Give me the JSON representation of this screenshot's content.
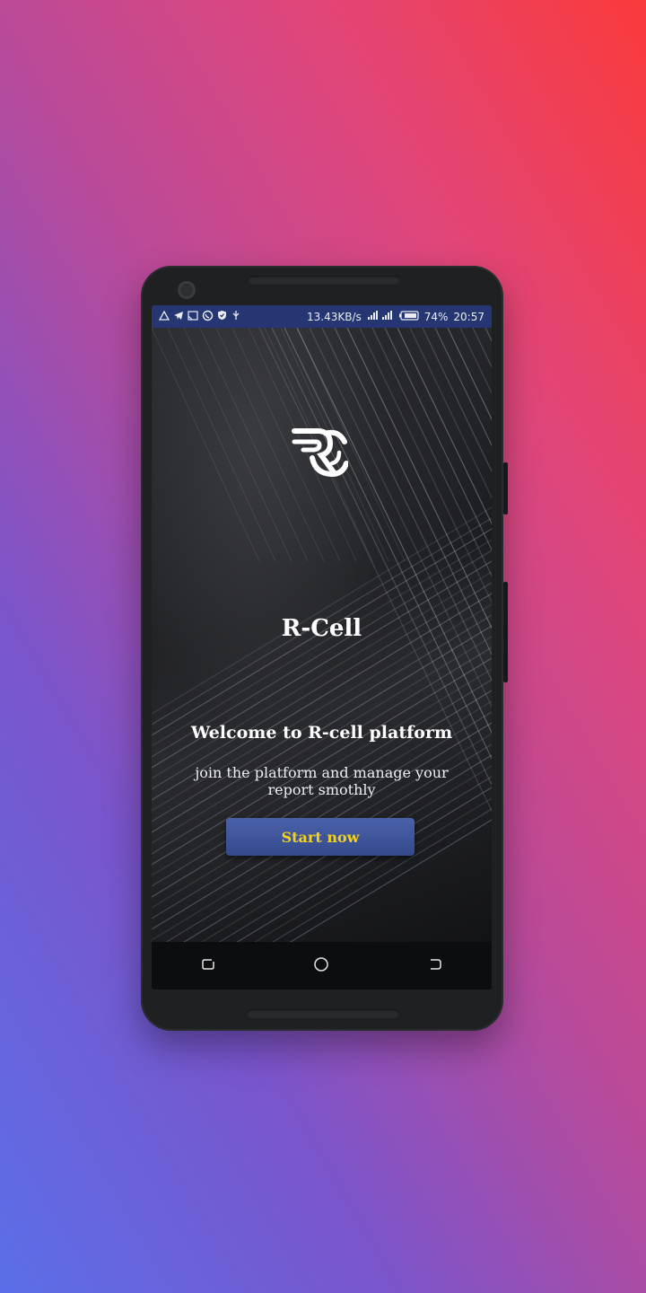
{
  "status_bar": {
    "left_icons": [
      "warning-icon",
      "telegram-icon",
      "cast-icon",
      "whatsapp-icon",
      "shield-icon",
      "usb-icon"
    ],
    "net_speed": "13.43KB/s",
    "battery": "74%",
    "time": "20:57"
  },
  "app": {
    "logo": "r-cell-logo",
    "title": "R-Cell",
    "welcome": "Welcome to R-cell platform",
    "subtitle": "join the platform and manage your report smothly",
    "start_button": "Start now",
    "button_text_color": "#f5d21a",
    "button_color": "#3f56a0"
  },
  "nav_bar": {
    "icons": [
      "recent-apps-icon",
      "home-icon",
      "back-icon"
    ]
  }
}
